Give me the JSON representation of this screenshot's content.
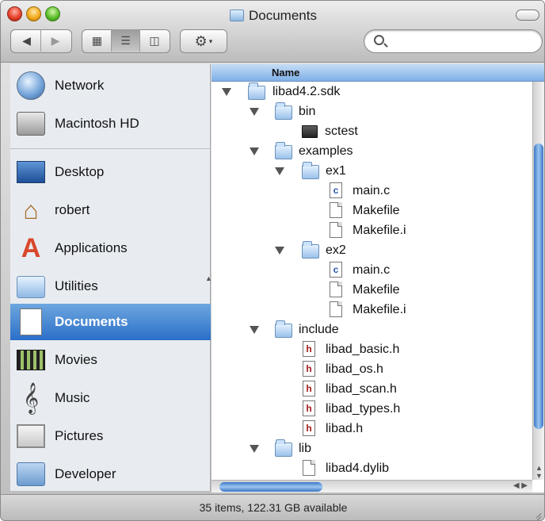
{
  "window": {
    "title": "Documents",
    "status": "35 items, 122.31 GB available"
  },
  "toolbar": {
    "back_icon": "back-arrow-icon",
    "forward_icon": "forward-arrow-icon",
    "views": [
      "icon-view",
      "list-view",
      "column-view"
    ],
    "selected_view": "list-view",
    "action_icon": "gear-icon"
  },
  "search": {
    "value": "",
    "placeholder": ""
  },
  "sidebar": {
    "items": [
      {
        "label": "Network",
        "icon": "network-globe-icon"
      },
      {
        "label": "Macintosh HD",
        "icon": "hard-drive-icon"
      },
      {
        "label": "Desktop",
        "icon": "desktop-icon"
      },
      {
        "label": "robert",
        "icon": "home-icon"
      },
      {
        "label": "Applications",
        "icon": "applications-icon"
      },
      {
        "label": "Utilities",
        "icon": "folder-icon"
      },
      {
        "label": "Documents",
        "icon": "documents-icon",
        "selected": true
      },
      {
        "label": "Movies",
        "icon": "movies-icon"
      },
      {
        "label": "Music",
        "icon": "music-icon"
      },
      {
        "label": "Pictures",
        "icon": "pictures-icon"
      },
      {
        "label": "Developer",
        "icon": "developer-icon"
      }
    ]
  },
  "list": {
    "header": "Name",
    "rows": [
      {
        "name": "libad4.2.sdk",
        "type": "folder",
        "depth": 0,
        "expanded": true
      },
      {
        "name": "bin",
        "type": "folder",
        "depth": 1,
        "expanded": true
      },
      {
        "name": "sctest",
        "type": "executable",
        "depth": 2
      },
      {
        "name": "examples",
        "type": "folder",
        "depth": 1,
        "expanded": true
      },
      {
        "name": "ex1",
        "type": "folder",
        "depth": 2,
        "expanded": true
      },
      {
        "name": "main.c",
        "type": "c-file",
        "depth": 3
      },
      {
        "name": "Makefile",
        "type": "file",
        "depth": 3
      },
      {
        "name": "Makefile.i",
        "type": "file",
        "depth": 3
      },
      {
        "name": "ex2",
        "type": "folder",
        "depth": 2,
        "expanded": true
      },
      {
        "name": "main.c",
        "type": "c-file",
        "depth": 3
      },
      {
        "name": "Makefile",
        "type": "file",
        "depth": 3
      },
      {
        "name": "Makefile.i",
        "type": "file",
        "depth": 3
      },
      {
        "name": "include",
        "type": "folder",
        "depth": 1,
        "expanded": true
      },
      {
        "name": "libad_basic.h",
        "type": "h-file",
        "depth": 2
      },
      {
        "name": "libad_os.h",
        "type": "h-file",
        "depth": 2
      },
      {
        "name": "libad_scan.h",
        "type": "h-file",
        "depth": 2
      },
      {
        "name": "libad_types.h",
        "type": "h-file",
        "depth": 2
      },
      {
        "name": "libad.h",
        "type": "h-file",
        "depth": 2
      },
      {
        "name": "lib",
        "type": "folder",
        "depth": 1,
        "expanded": true
      },
      {
        "name": "libad4.dylib",
        "type": "file",
        "depth": 2
      }
    ]
  },
  "colors": {
    "selection": "#2a6fc9",
    "header": "#7fb0e8",
    "scroll_thumb": "#3d78c7"
  }
}
